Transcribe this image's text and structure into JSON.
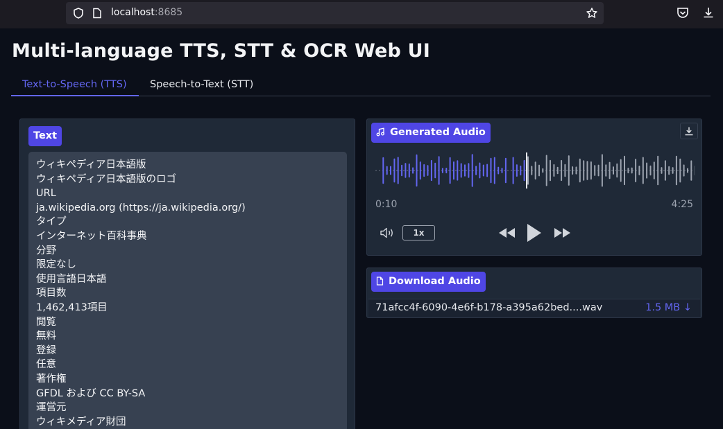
{
  "browser": {
    "url_host": "localhost",
    "url_port": ":8685"
  },
  "app": {
    "title": "Multi-language TTS, STT & OCR Web UI"
  },
  "tabs": [
    {
      "label": "Text-to-Speech (TTS)",
      "active": true
    },
    {
      "label": "Speech-to-Text (STT)",
      "active": false
    }
  ],
  "text_panel": {
    "label": "Text",
    "value": "ウィキペディア日本語版\nウィキペディア日本語版のロゴ\nURL\nja.wikipedia.org (https://ja.wikipedia.org/)\nタイプ\nインターネット百科事典\n分野\n限定なし\n使用言語日本語\n項目数\n1,462,413項目\n閲覧\n無料\n登録\n任意\n著作権\nGFDL および CC BY-SA\n運営元\nウィキメディア財団"
  },
  "audio_panel": {
    "label": "Generated Audio",
    "current_time": "0:10",
    "duration": "4:25",
    "playback_rate": "1x"
  },
  "download_panel": {
    "label": "Download Audio",
    "file_name": "71afcc4f-6090-4e6f-b178-a395a62bed....wav",
    "file_size": "1.5 MB ↓"
  },
  "colors": {
    "accent": "#6366f1",
    "badge": "#4f46e5",
    "panel": "#1f2937",
    "background": "#0b0f19"
  }
}
